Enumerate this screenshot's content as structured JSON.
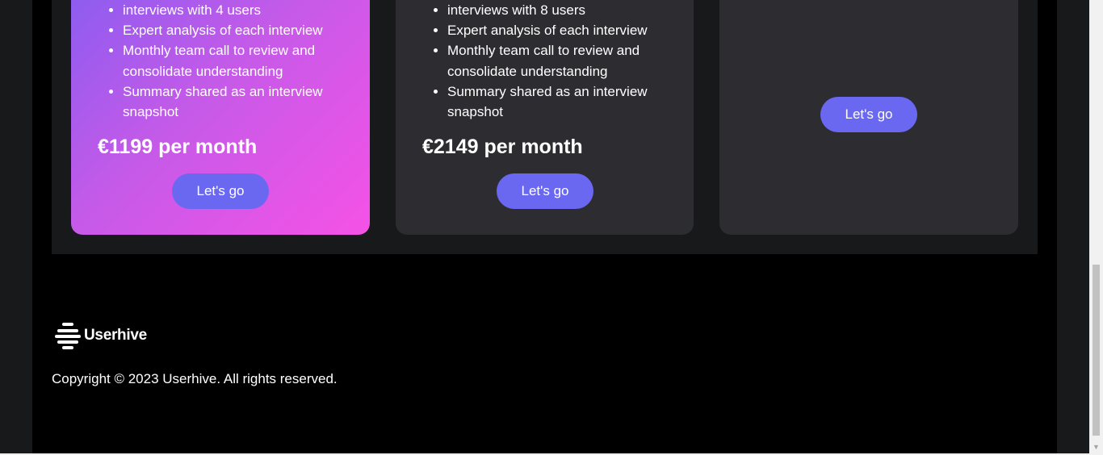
{
  "pricing": {
    "cards": [
      {
        "features": [
          "interviews with 4 users",
          "Expert analysis of each interview",
          "Monthly team call to review and consolidate understanding",
          "Summary shared as an interview snapshot"
        ],
        "price": "€1199 per month",
        "cta_label": "Let's go"
      },
      {
        "features": [
          "interviews with 8 users",
          "Expert analysis of each interview",
          "Monthly team call to review and consolidate understanding",
          "Summary shared as an interview snapshot"
        ],
        "price": "€2149 per month",
        "cta_label": "Let's go"
      },
      {
        "cta_label": "Let's go"
      }
    ]
  },
  "footer": {
    "brand_name": "Userhive",
    "logo_icon": "userhive-logo-icon",
    "copyright": "Copyright © 2023 Userhive. All rights reserved."
  },
  "colors": {
    "accent": "#6a68f1",
    "card_gradient_start": "#8a5cf0",
    "card_gradient_end": "#f552e6",
    "card_dark": "#2d2c31",
    "section_bg": "#18191b",
    "page_bg": "#000000"
  }
}
